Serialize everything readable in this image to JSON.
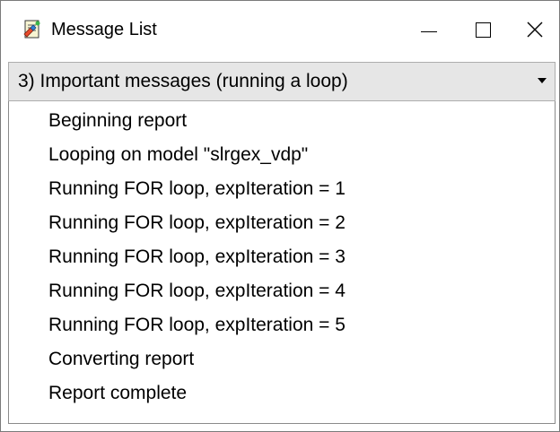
{
  "window": {
    "title": "Message List",
    "icon": "report-icon"
  },
  "controls": {
    "minimize": "minimize-icon",
    "maximize": "maximize-icon",
    "close": "close-icon"
  },
  "filter": {
    "selected": "3) Important messages (running a loop)"
  },
  "messages": [
    "Beginning report",
    "Looping on model \"slrgex_vdp\"",
    "Running FOR loop, expIteration = 1",
    "Running FOR loop, expIteration = 2",
    "Running FOR loop, expIteration = 3",
    "Running FOR loop, expIteration = 4",
    "Running FOR loop, expIteration = 5",
    "Converting report",
    "Report complete"
  ]
}
